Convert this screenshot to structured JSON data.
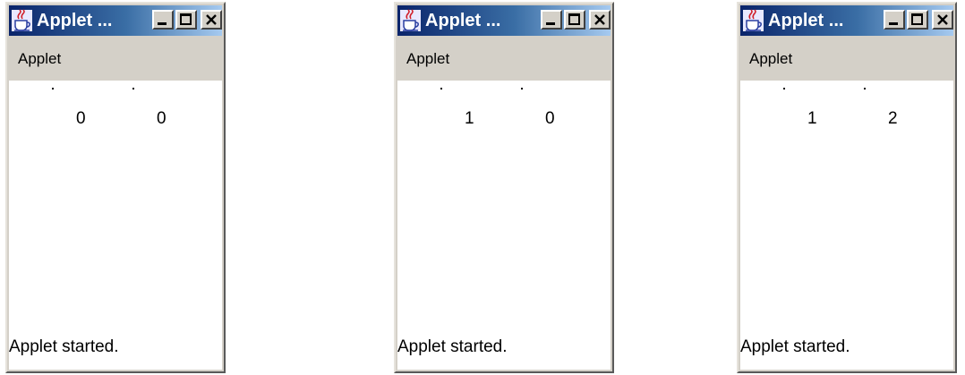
{
  "windows": [
    {
      "title": "Applet ...",
      "menu": "Applet",
      "values": [
        "0",
        "0"
      ],
      "status": "Applet started."
    },
    {
      "title": "Applet ...",
      "menu": "Applet",
      "values": [
        "1",
        "0"
      ],
      "status": "Applet started."
    },
    {
      "title": "Applet ...",
      "menu": "Applet",
      "values": [
        "1",
        "2"
      ],
      "status": "Applet started."
    }
  ],
  "icons": {
    "app": "java-coffee-cup-icon",
    "minimize": "minimize-icon",
    "maximize": "maximize-icon",
    "close": "close-icon"
  },
  "colors": {
    "titlebar_start": "#0a246a",
    "titlebar_end": "#a6caf0",
    "chrome": "#d4d0c8",
    "content_bg": "#ffffff"
  }
}
